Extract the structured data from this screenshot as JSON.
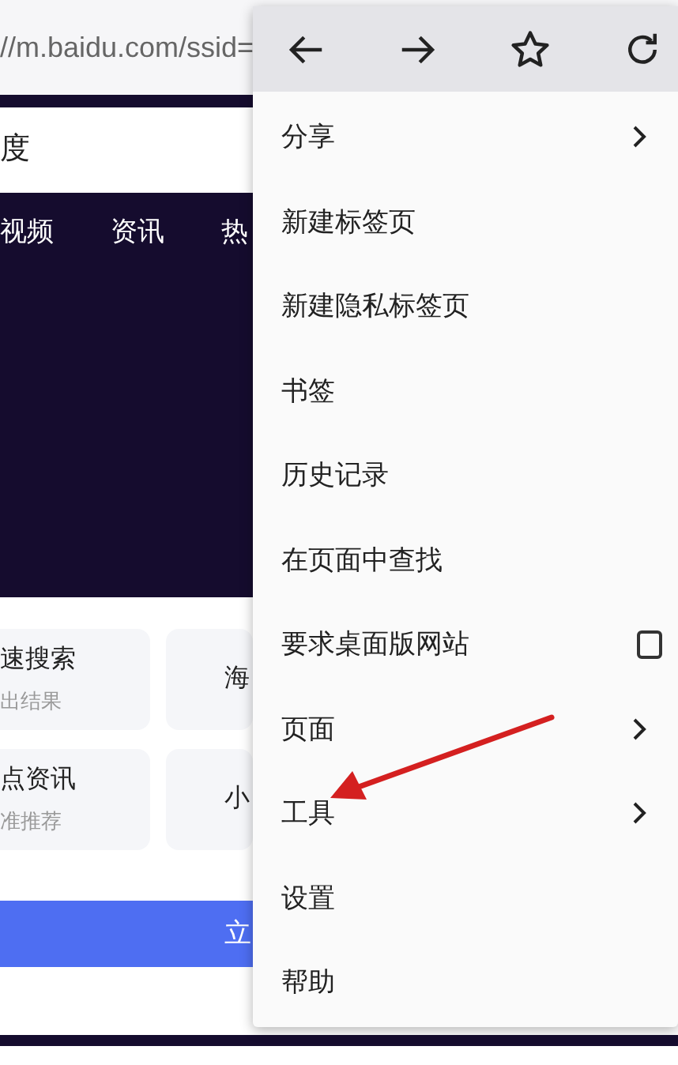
{
  "url_bar": {
    "url": "//m.baidu.com/ssid="
  },
  "search_box": {
    "value": "度"
  },
  "nav_tabs": [
    "视频",
    "资讯",
    "热"
  ],
  "cards": [
    {
      "title": "速搜索",
      "subtitle": "出结果"
    },
    {
      "title": "海"
    },
    {
      "title": "点资讯",
      "subtitle": "准推荐"
    },
    {
      "title": "小"
    }
  ],
  "primary_button": {
    "label": "立"
  },
  "menu": {
    "toolbar": [
      {
        "kind": "back"
      },
      {
        "kind": "forward"
      },
      {
        "kind": "star"
      },
      {
        "kind": "reload"
      }
    ],
    "items": [
      {
        "label": "分享",
        "kind": "submenu"
      },
      {
        "label": "新建标签页",
        "kind": "plain"
      },
      {
        "label": "新建隐私标签页",
        "kind": "plain"
      },
      {
        "label": "书签",
        "kind": "plain"
      },
      {
        "label": "历史记录",
        "kind": "plain"
      },
      {
        "label": "在页面中查找",
        "kind": "plain"
      },
      {
        "label": "要求桌面版网站",
        "kind": "checkbox",
        "checked": false
      },
      {
        "label": "页面",
        "kind": "submenu"
      },
      {
        "label": "工具",
        "kind": "submenu"
      },
      {
        "label": "设置",
        "kind": "plain"
      },
      {
        "label": "帮助",
        "kind": "plain"
      }
    ]
  },
  "annotation": {
    "kind": "arrow"
  }
}
